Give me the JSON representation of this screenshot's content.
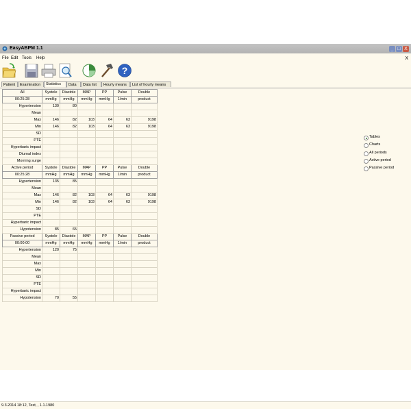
{
  "window": {
    "title": "EasyABPM 1.1",
    "min_label": "_",
    "max_label": "□",
    "close_label": "X"
  },
  "menu": {
    "file": "File",
    "edit": "Edit",
    "tools": "Tools",
    "help": "Help",
    "close_x": "X"
  },
  "toolbar": {
    "icons": [
      "open-folder-icon",
      "save-disk-icon",
      "printer-icon",
      "print-preview-icon",
      "pie-chart-icon",
      "hammer-icon",
      "help-icon"
    ]
  },
  "tabs": [
    {
      "label": "Patient"
    },
    {
      "label": "Examination"
    },
    {
      "label": "Statistics",
      "active": true
    },
    {
      "label": "Data"
    },
    {
      "label": "Data list"
    },
    {
      "label": "Hourly means"
    },
    {
      "label": "List of hourly means"
    }
  ],
  "table": {
    "rows": [
      {
        "type": "hdr",
        "cells": [
          "All",
          "Systole",
          "Diastole",
          "MAP",
          "PP",
          "Pulse",
          "Double"
        ]
      },
      {
        "type": "unit",
        "cells": [
          "00:25:28",
          "mmHg",
          "mmHg",
          "mmHg",
          "mmHg",
          "1/min",
          "product"
        ]
      },
      {
        "cells": [
          "Hypertension",
          "130",
          "80",
          "",
          "",
          "",
          ""
        ]
      },
      {
        "cells": [
          "Mean",
          "",
          "",
          "",
          "",
          "",
          ""
        ]
      },
      {
        "cells": [
          "Max",
          "146",
          "82",
          "103",
          "64",
          "63",
          "9198"
        ]
      },
      {
        "cells": [
          "Min",
          "146",
          "82",
          "103",
          "64",
          "63",
          "9198"
        ]
      },
      {
        "cells": [
          "SD",
          "",
          "",
          "",
          "",
          "",
          ""
        ]
      },
      {
        "cells": [
          "PTE",
          "",
          "",
          "",
          "",
          "",
          ""
        ]
      },
      {
        "cells": [
          "Hyperbaric impact",
          "",
          "",
          "",
          "",
          "",
          ""
        ]
      },
      {
        "cells": [
          "Diurnal index",
          "",
          "",
          "",
          "",
          "",
          ""
        ]
      },
      {
        "cells": [
          "Morning surge",
          "",
          "",
          "",
          "",
          "",
          ""
        ]
      },
      {
        "type": "hdr",
        "cells": [
          "Active period",
          "Systole",
          "Diastole",
          "MAP",
          "PP",
          "Pulse",
          "Double"
        ]
      },
      {
        "type": "unit",
        "cells": [
          "00:25:28",
          "mmHg",
          "mmHg",
          "mmHg",
          "mmHg",
          "1/min",
          "product"
        ]
      },
      {
        "cells": [
          "Hypertension",
          "135",
          "85",
          "",
          "",
          "",
          ""
        ]
      },
      {
        "cells": [
          "Mean",
          "",
          "",
          "",
          "",
          "",
          ""
        ]
      },
      {
        "cells": [
          "Max",
          "146",
          "82",
          "103",
          "64",
          "63",
          "9198"
        ]
      },
      {
        "cells": [
          "Min",
          "146",
          "82",
          "103",
          "64",
          "63",
          "9198"
        ]
      },
      {
        "cells": [
          "SD",
          "",
          "",
          "",
          "",
          "",
          ""
        ]
      },
      {
        "cells": [
          "PTE",
          "",
          "",
          "",
          "",
          "",
          ""
        ]
      },
      {
        "cells": [
          "Hyperbaric impact",
          "",
          "",
          "",
          "",
          "",
          ""
        ]
      },
      {
        "cells": [
          "Hypotension",
          "85",
          "65",
          "",
          "",
          "",
          ""
        ]
      },
      {
        "type": "hdr",
        "cells": [
          "Passive period",
          "Systole",
          "Diastole",
          "MAP",
          "PP",
          "Pulse",
          "Double"
        ]
      },
      {
        "type": "unit",
        "cells": [
          "00:00:00",
          "mmHg",
          "mmHg",
          "mmHg",
          "mmHg",
          "1/min",
          "product"
        ]
      },
      {
        "cells": [
          "Hypertension",
          "120",
          "75",
          "",
          "",
          "",
          ""
        ]
      },
      {
        "cells": [
          "Mean",
          "",
          "",
          "",
          "",
          "",
          ""
        ]
      },
      {
        "cells": [
          "Max",
          "",
          "",
          "",
          "",
          "",
          ""
        ]
      },
      {
        "cells": [
          "Min",
          "",
          "",
          "",
          "",
          "",
          ""
        ]
      },
      {
        "cells": [
          "SD",
          "",
          "",
          "",
          "",
          "",
          ""
        ]
      },
      {
        "cells": [
          "PTE",
          "",
          "",
          "",
          "",
          "",
          ""
        ]
      },
      {
        "cells": [
          "Hyperbaric impact",
          "",
          "",
          "",
          "",
          "",
          ""
        ]
      },
      {
        "cells": [
          "Hypotension",
          "70",
          "55",
          "",
          "",
          "",
          ""
        ]
      }
    ]
  },
  "options": [
    {
      "label": "Tables",
      "selected": true
    },
    {
      "label": "Charts",
      "selected": false
    },
    {
      "label": "All periods",
      "selected": false
    },
    {
      "label": "Active period",
      "selected": false
    },
    {
      "label": "Passive period",
      "selected": false
    }
  ],
  "status": {
    "text": "9.3.2014 18:12, Test, , 1.1.1980"
  },
  "colors": {
    "background": "#fdf9ec",
    "titlebar": "#b8b8b8",
    "grid_line": "#d9d4c4"
  }
}
